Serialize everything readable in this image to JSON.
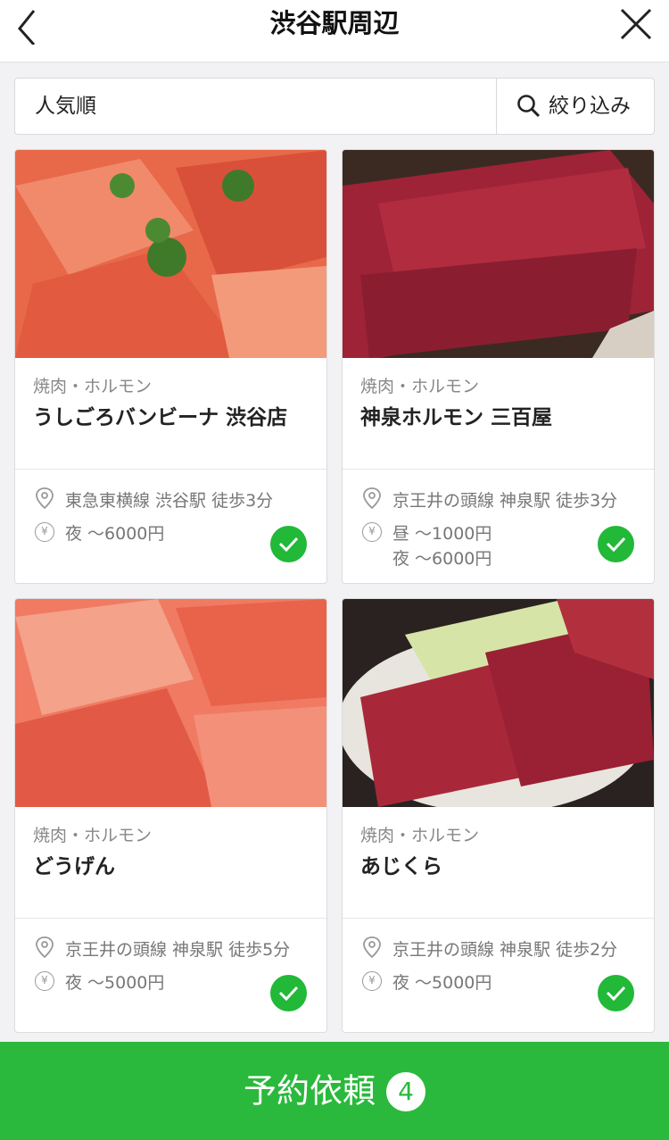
{
  "header": {
    "title": "渋谷駅周辺"
  },
  "sort": {
    "label": "人気順",
    "filter_label": "絞り込み"
  },
  "restaurants": [
    {
      "category": "焼肉・ホルモン",
      "name": "うしごろバンビーナ 渋谷店",
      "access": "東急東横線 渋谷駅 徒歩3分",
      "prices": [
        "夜 〜6000円"
      ],
      "selected": true
    },
    {
      "category": "焼肉・ホルモン",
      "name": "神泉ホルモン 三百屋",
      "access": "京王井の頭線 神泉駅 徒歩3分",
      "prices": [
        "昼 〜1000円",
        "夜 〜6000円"
      ],
      "selected": true
    },
    {
      "category": "焼肉・ホルモン",
      "name": "どうげん",
      "access": "京王井の頭線 神泉駅 徒歩5分",
      "prices": [
        "夜 〜5000円"
      ],
      "selected": true
    },
    {
      "category": "焼肉・ホルモン",
      "name": "あじくら",
      "access": "京王井の頭線 神泉駅 徒歩2分",
      "prices": [
        "夜 〜5000円"
      ],
      "selected": true
    }
  ],
  "icons": {
    "yen": "¥"
  },
  "footer": {
    "label": "予約依頼",
    "count": "4"
  },
  "colors": {
    "accent": "#2ab93c",
    "check": "#22b838"
  }
}
